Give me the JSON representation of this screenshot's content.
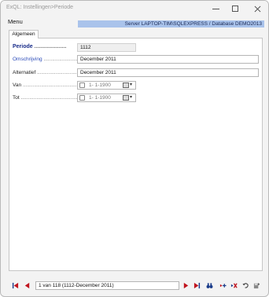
{
  "window": {
    "title": "ExQL: Instellingen>Periode"
  },
  "menu": {
    "label": "Menu"
  },
  "server_info": "Server LAPTOP-TIM\\SQLEXPRESS / Database DEMO2013",
  "tabs": [
    {
      "label": "Algemeen",
      "active": true
    }
  ],
  "form": {
    "periode": {
      "label": "Periode",
      "value": "1112"
    },
    "omschrijving": {
      "label": "Omschrijving",
      "value": "December 2011"
    },
    "alternatief": {
      "label": "Alternatief",
      "value": "December 2011"
    },
    "van": {
      "label": "Van",
      "value": "1- 1-1900",
      "checked": false
    },
    "tot": {
      "label": "Tot",
      "value": "1- 1-1900",
      "checked": false
    }
  },
  "navigator": {
    "record_text": "1 van 118 (1112-December 2011)"
  },
  "colors": {
    "server_bar": "#a9c3eb",
    "nav_red": "#c0141e",
    "nav_blue": "#1a3c8a",
    "label_bold": "#1a2d8a",
    "label_blue": "#2a4ab8"
  },
  "icons": {
    "first": "first-record-icon",
    "prev": "previous-record-icon",
    "next": "next-record-icon",
    "last": "last-record-icon",
    "search": "binoculars-icon",
    "new": "new-record-icon",
    "delete": "delete-record-icon",
    "undo": "undo-icon",
    "save": "save-icon"
  }
}
